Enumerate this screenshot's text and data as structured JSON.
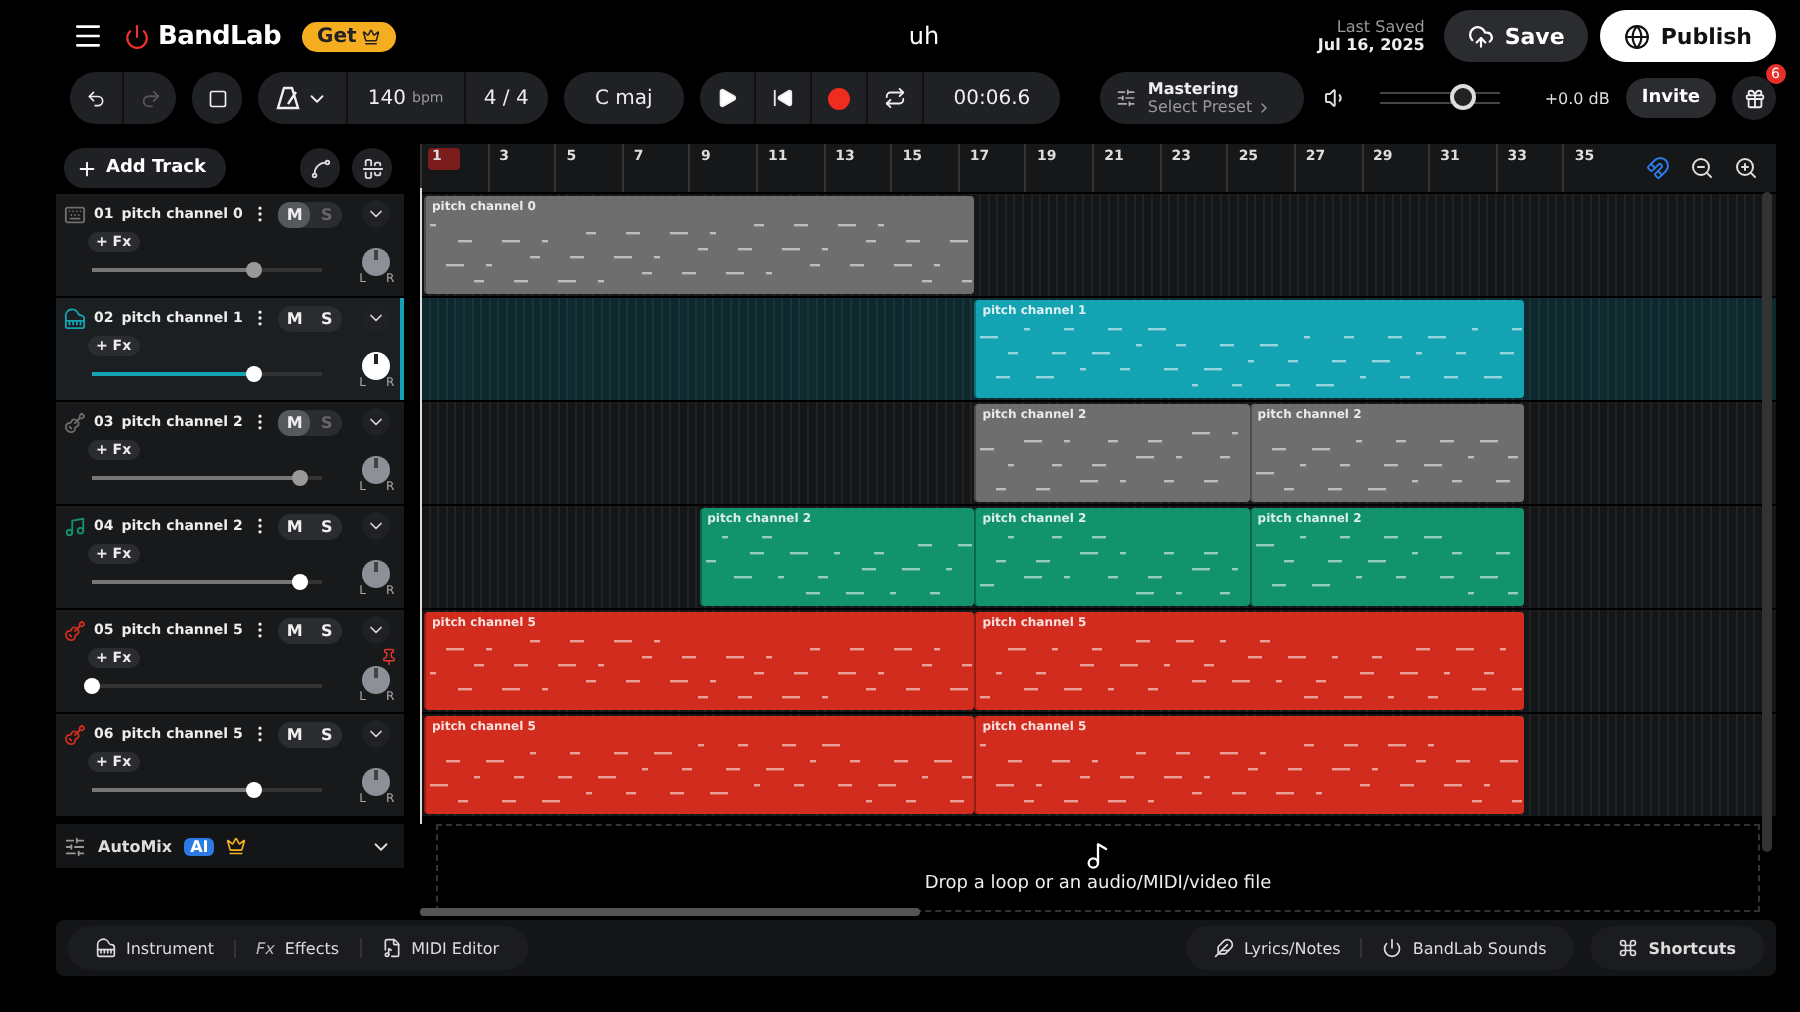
{
  "header": {
    "app_name": "BandLab",
    "get_label": "Get",
    "title": "uh",
    "last_saved_label": "Last Saved",
    "last_saved_date": "Jul 16, 2025",
    "save_label": "Save",
    "publish_label": "Publish"
  },
  "toolbar": {
    "bpm": "140",
    "bpm_unit": "bpm",
    "time_signature": "4 / 4",
    "key": "C maj",
    "time": "00:06.6",
    "mastering_title": "Mastering",
    "mastering_preset": "Select Preset",
    "master_volume": {
      "level": 0.68
    },
    "gain": "+0.0 dB",
    "invite_label": "Invite",
    "notifications": "6"
  },
  "add_track_label": "Add Track",
  "ruler": [
    {
      "label": "1",
      "highlighted": true
    },
    {
      "label": "3",
      "highlighted": false
    },
    {
      "label": "5",
      "highlighted": false
    },
    {
      "label": "7",
      "highlighted": false
    },
    {
      "label": "9",
      "highlighted": false
    },
    {
      "label": "11",
      "highlighted": false
    },
    {
      "label": "13",
      "highlighted": false
    },
    {
      "label": "15",
      "highlighted": false
    },
    {
      "label": "17",
      "highlighted": false
    },
    {
      "label": "19",
      "highlighted": false
    },
    {
      "label": "21",
      "highlighted": false
    },
    {
      "label": "23",
      "highlighted": false
    },
    {
      "label": "25",
      "highlighted": false
    },
    {
      "label": "27",
      "highlighted": false
    },
    {
      "label": "29",
      "highlighted": false
    },
    {
      "label": "31",
      "highlighted": false
    },
    {
      "label": "33",
      "highlighted": false
    },
    {
      "label": "35",
      "highlighted": false
    }
  ],
  "tracks": [
    {
      "number": "01",
      "name": "pitch channel 0",
      "kind": "keyboard",
      "color": "#6e6e6e",
      "muted": true,
      "selected": false,
      "automation": false,
      "level": 0.7,
      "fx_label": "+ Fx",
      "mute_label": "M",
      "solo_label": "S",
      "pan_left": "L",
      "pan_right": "R",
      "clips": [
        {
          "label": "pitch channel 0"
        }
      ]
    },
    {
      "number": "02",
      "name": "pitch channel 1",
      "kind": "piano",
      "color": "#14a3b2",
      "muted": false,
      "selected": true,
      "automation": false,
      "level": 0.7,
      "fx_label": "+ Fx",
      "mute_label": "M",
      "solo_label": "S",
      "pan_left": "L",
      "pan_right": "R",
      "clips": [
        {
          "label": "pitch channel 1"
        }
      ]
    },
    {
      "number": "03",
      "name": "pitch channel 2",
      "kind": "guitar",
      "color": "#6e6e6e",
      "muted": true,
      "selected": false,
      "automation": false,
      "level": 0.9,
      "fx_label": "+ Fx",
      "mute_label": "M",
      "solo_label": "S",
      "pan_left": "L",
      "pan_right": "R",
      "clips": [
        {
          "label": "pitch channel 2"
        },
        {
          "label": "pitch channel 2"
        }
      ]
    },
    {
      "number": "04",
      "name": "pitch channel 2",
      "kind": "sax",
      "color": "#12936b",
      "muted": false,
      "selected": false,
      "automation": false,
      "level": 0.9,
      "fx_label": "+ Fx",
      "mute_label": "M",
      "solo_label": "S",
      "pan_left": "L",
      "pan_right": "R",
      "clips": [
        {
          "label": "pitch channel 2"
        },
        {
          "label": "pitch channel 2"
        },
        {
          "label": "pitch channel 2"
        }
      ]
    },
    {
      "number": "05",
      "name": "pitch channel 5",
      "kind": "guitar",
      "color": "#d12c1e",
      "muted": false,
      "selected": false,
      "automation": true,
      "level": 0,
      "fx_label": "+ Fx",
      "mute_label": "M",
      "solo_label": "S",
      "pan_left": "L",
      "pan_right": "R",
      "clips": [
        {
          "label": "pitch channel 5"
        },
        {
          "label": "pitch channel 5"
        }
      ]
    },
    {
      "number": "06",
      "name": "pitch channel 5",
      "kind": "guitar",
      "color": "#d12c1e",
      "muted": false,
      "selected": false,
      "automation": false,
      "level": 0.7,
      "fx_label": "+ Fx",
      "mute_label": "M",
      "solo_label": "S",
      "pan_left": "L",
      "pan_right": "R",
      "clips": [
        {
          "label": "pitch channel 5"
        },
        {
          "label": "pitch channel 5"
        }
      ]
    }
  ],
  "automix": {
    "label": "AutoMix",
    "badge": "AI"
  },
  "drop_zone": "Drop a loop or an audio/MIDI/video file",
  "bottom_left": [
    {
      "kind": "instrument",
      "label": "Instrument"
    },
    {
      "kind": "effects",
      "icon_text": "Fx",
      "label": "Effects"
    },
    {
      "kind": "midi",
      "label": "MIDI Editor"
    }
  ],
  "bottom_right": [
    {
      "kind": "lyrics",
      "label": "Lyrics/Notes"
    },
    {
      "kind": "sounds",
      "label": "BandLab Sounds"
    }
  ],
  "shortcuts_label": "Shortcuts"
}
